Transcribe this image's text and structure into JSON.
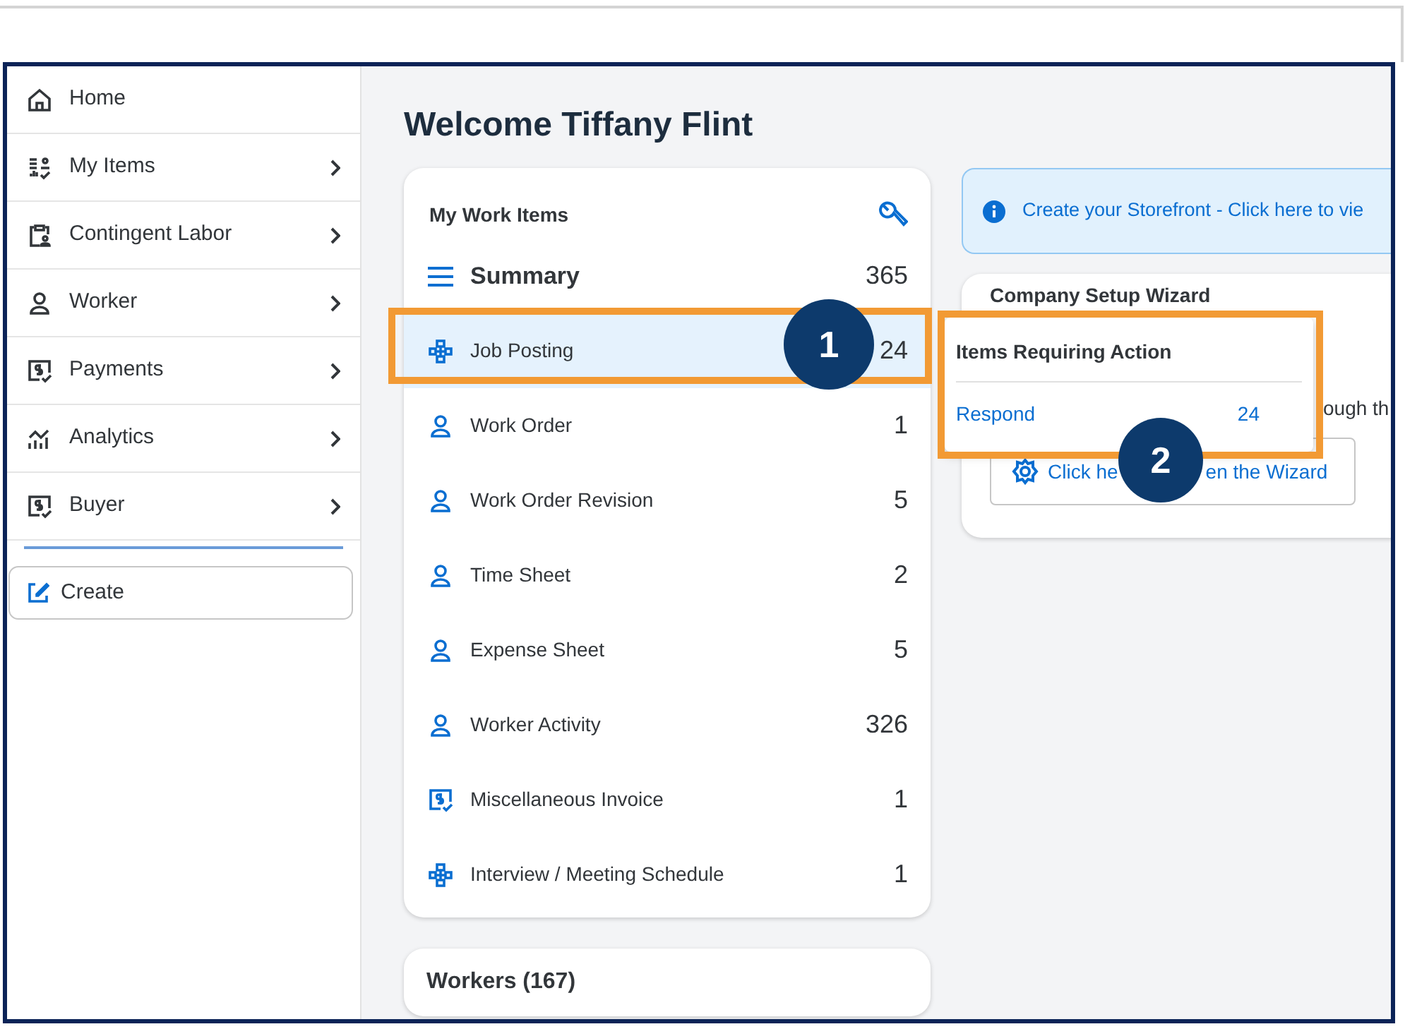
{
  "sidebar": {
    "items": [
      {
        "label": "Home",
        "kind": "home",
        "has_submenu": false
      },
      {
        "label": "My Items",
        "kind": "items",
        "has_submenu": true
      },
      {
        "label": "Contingent Labor",
        "kind": "clipboard",
        "has_submenu": true
      },
      {
        "label": "Worker",
        "kind": "person",
        "has_submenu": true
      },
      {
        "label": "Payments",
        "kind": "payment",
        "has_submenu": true
      },
      {
        "label": "Analytics",
        "kind": "analytics",
        "has_submenu": true
      },
      {
        "label": "Buyer",
        "kind": "payment",
        "has_submenu": true
      }
    ],
    "create_button": "Create"
  },
  "main": {
    "heading": "Welcome Tiffany Flint",
    "work_items": {
      "title": "My Work Items",
      "summary": {
        "label": "Summary",
        "count": "365"
      },
      "rows": [
        {
          "label": "Job Posting",
          "count": "24",
          "kind": "network",
          "selected": true
        },
        {
          "label": "Work Order",
          "count": "1",
          "kind": "person",
          "selected": false
        },
        {
          "label": "Work Order Revision",
          "count": "5",
          "kind": "person",
          "selected": false
        },
        {
          "label": "Time Sheet",
          "count": "2",
          "kind": "person",
          "selected": false
        },
        {
          "label": "Expense Sheet",
          "count": "5",
          "kind": "person",
          "selected": false
        },
        {
          "label": "Worker Activity",
          "count": "326",
          "kind": "person",
          "selected": false
        },
        {
          "label": "Miscellaneous Invoice",
          "count": "1",
          "kind": "payment",
          "selected": false
        },
        {
          "label": "Interview / Meeting Schedule",
          "count": "1",
          "kind": "network",
          "selected": false
        }
      ]
    },
    "workers_card": {
      "title": "Workers (167)"
    },
    "storefront_banner": {
      "text": "Create your Storefront - Click here to vie"
    },
    "wizard_card": {
      "title": "Company Setup Wizard",
      "description": "ough th",
      "button_parts": [
        "Click he",
        "en the Wizard"
      ]
    },
    "popover": {
      "title": "Items Requiring Action",
      "rows": [
        {
          "label": "Respond",
          "count": "24"
        }
      ]
    }
  },
  "callouts": [
    {
      "number": "1"
    },
    {
      "number": "2"
    }
  ]
}
